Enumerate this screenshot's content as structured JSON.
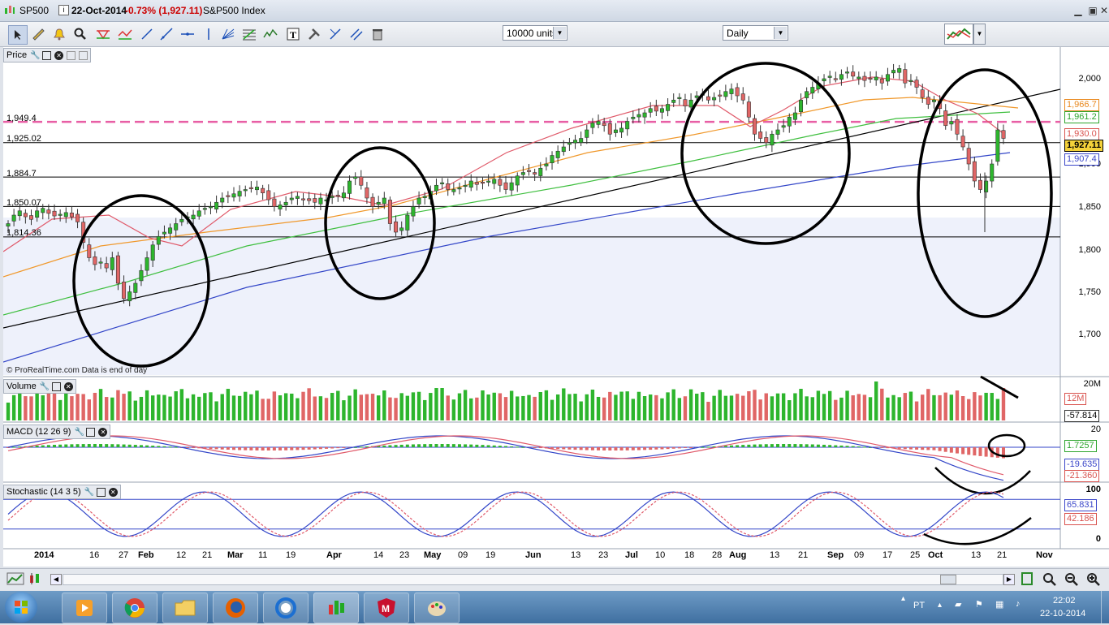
{
  "window": {
    "symbol": "SP500",
    "date": "22-Oct-2014",
    "change": "-0.73% (1,927.11)",
    "name": "S&P500 Index"
  },
  "toolbar": {
    "units_value": "10000 units",
    "period_value": "Daily"
  },
  "panes": {
    "price": {
      "title": "Price"
    },
    "volume": {
      "title": "Volume"
    },
    "macd": {
      "title": "MACD (12 26 9)"
    },
    "stochastic": {
      "title": "Stochastic (14 3 5)"
    }
  },
  "price_axis": {
    "ticks": [
      "2,000",
      "1,900",
      "1,850",
      "1,800",
      "1,750",
      "1,700"
    ],
    "left_levels": [
      "1,949.4",
      "1,925.02",
      "1,884.7",
      "1,850.07",
      "1,814.36"
    ],
    "tags": [
      {
        "text": "1,966.7",
        "color": "#e9891f"
      },
      {
        "text": "1,961.2",
        "color": "#2ea52e"
      },
      {
        "text": "1,930.0",
        "color": "#d9534f"
      },
      {
        "text": "1,927.11",
        "color": "#000000"
      },
      {
        "text": "1,907.4",
        "color": "#3a46c9"
      }
    ]
  },
  "volume_axis": {
    "ticks": [
      "20M",
      "12M"
    ],
    "value": "-57.814"
  },
  "macd_axis": {
    "ticks": [
      "20"
    ],
    "values": [
      "1.7257",
      "-19.635",
      "-21.360"
    ]
  },
  "stoch_axis": {
    "ticks": [
      "100",
      "0"
    ],
    "values": [
      "65.831",
      "42.186"
    ]
  },
  "watermark": "© ProRealTime.com  Data is end of day",
  "x_axis": {
    "labels": [
      {
        "text": "2014",
        "bold": true
      },
      {
        "text": "16",
        "bold": false
      },
      {
        "text": "27",
        "bold": false
      },
      {
        "text": "Feb",
        "bold": true
      },
      {
        "text": "12",
        "bold": false
      },
      {
        "text": "21",
        "bold": false
      },
      {
        "text": "Mar",
        "bold": true
      },
      {
        "text": "11",
        "bold": false
      },
      {
        "text": "19",
        "bold": false
      },
      {
        "text": "Apr",
        "bold": true
      },
      {
        "text": "14",
        "bold": false
      },
      {
        "text": "23",
        "bold": false
      },
      {
        "text": "May",
        "bold": true
      },
      {
        "text": "09",
        "bold": false
      },
      {
        "text": "19",
        "bold": false
      },
      {
        "text": "Jun",
        "bold": true
      },
      {
        "text": "13",
        "bold": false
      },
      {
        "text": "23",
        "bold": false
      },
      {
        "text": "Jul",
        "bold": true
      },
      {
        "text": "10",
        "bold": false
      },
      {
        "text": "18",
        "bold": false
      },
      {
        "text": "28",
        "bold": false
      },
      {
        "text": "Aug",
        "bold": true
      },
      {
        "text": "13",
        "bold": false
      },
      {
        "text": "21",
        "bold": false
      },
      {
        "text": "Sep",
        "bold": true
      },
      {
        "text": "09",
        "bold": false
      },
      {
        "text": "17",
        "bold": false
      },
      {
        "text": "25",
        "bold": false
      },
      {
        "text": "Oct",
        "bold": true
      },
      {
        "text": "13",
        "bold": false
      },
      {
        "text": "21",
        "bold": false
      },
      {
        "text": "Nov",
        "bold": true
      }
    ]
  },
  "taskbar": {
    "language": "PT",
    "time": "22:02",
    "date": "22-10-2014"
  },
  "colors": {
    "bull": "#2db52d",
    "bear": "#e06666",
    "pink_dash": "#e85fa5",
    "ma_red": "#e05a6a",
    "ma_orange": "#f0982b",
    "ma_green": "#3fbf3f",
    "ma_blue": "#3346c8"
  },
  "icons": [
    "pointer-icon",
    "ruler-icon",
    "alarm-bell-icon",
    "zoom-icon",
    "trendline-icon",
    "channel-icon",
    "fibonacci-icon",
    "hline-icon",
    "vline-icon",
    "fan-icon",
    "text-icon",
    "tools-icon",
    "delete-icon"
  ]
}
